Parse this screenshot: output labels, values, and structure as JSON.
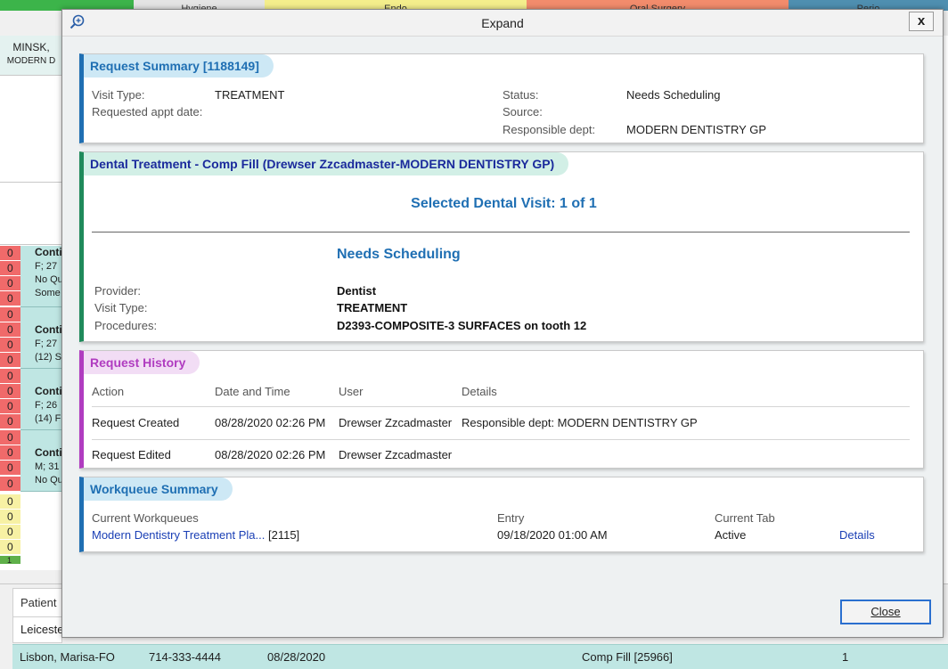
{
  "background": {
    "tabs": [
      {
        "label": "Hygiene",
        "color": "#e4e4e4"
      },
      {
        "label": "Endo",
        "color": "#f4ee8c"
      },
      {
        "label": "Oral Surgery",
        "color": "#f28c6c"
      },
      {
        "label": "Perio",
        "color": "#4f8fb0"
      }
    ],
    "column_header": {
      "name": "MINSK,",
      "dept": "MODERN D"
    },
    "counts": [
      "0",
      "0",
      "0",
      "0",
      "0",
      "0",
      "0",
      "0",
      "0",
      "0",
      "0",
      "0",
      "0",
      "0",
      "0",
      "0",
      "0",
      "0",
      "0",
      "0",
      "1"
    ],
    "appointments": [
      {
        "lines": [
          "Conti",
          "F; 27",
          "No Qu",
          "Some"
        ]
      },
      {
        "lines": [
          "Conti",
          "F; 27",
          "(12) S"
        ]
      },
      {
        "lines": [
          "Conti",
          "F; 26",
          "(14) F"
        ]
      },
      {
        "lines": [
          "Conti",
          "M; 31",
          "No Qu"
        ]
      }
    ],
    "bottom_table": {
      "header": "Patient",
      "cell": "Leiceste"
    },
    "selected_row": {
      "patient": "Lisbon, Marisa-FO",
      "phone": "714-333-4444",
      "date": "08/28/2020",
      "procedure": "Comp Fill [25966]",
      "count": "1"
    }
  },
  "window": {
    "title": "Expand",
    "close_x": "x"
  },
  "request_summary": {
    "header": "Request Summary [1188149]",
    "visit_type_label": "Visit Type:",
    "visit_type": "TREATMENT",
    "requested_date_label": "Requested appt date:",
    "requested_date": "",
    "status_label": "Status:",
    "status": "Needs Scheduling",
    "source_label": "Source:",
    "source": "",
    "dept_label": "Responsible dept:",
    "dept": "MODERN DENTISTRY GP"
  },
  "dental_treatment": {
    "header": "Dental Treatment - Comp Fill (Drewser Zzcadmaster-MODERN DENTISTRY GP)",
    "selected_visit": "Selected Dental Visit: 1 of 1",
    "status": "Needs Scheduling",
    "provider_label": "Provider:",
    "provider": "Dentist",
    "visit_type_label": "Visit Type:",
    "visit_type": "TREATMENT",
    "procedures_label": "Procedures:",
    "procedures": "D2393-COMPOSITE-3 SURFACES on tooth 12"
  },
  "request_history": {
    "header": "Request History",
    "columns": [
      "Action",
      "Date and Time",
      "User",
      "Details"
    ],
    "rows": [
      {
        "action": "Request Created",
        "datetime": "08/28/2020 02:26 PM",
        "user": "Drewser Zzcadmaster",
        "details": "Responsible dept: MODERN DENTISTRY GP"
      },
      {
        "action": "Request Edited",
        "datetime": "08/28/2020 02:26 PM",
        "user": "Drewser Zzcadmaster",
        "details": ""
      }
    ]
  },
  "workqueue_summary": {
    "header": "Workqueue Summary",
    "current_label": "Current Workqueues",
    "current_link": "Modern Dentistry Treatment Pla...",
    "current_id": "[2115]",
    "entry_label": "Entry",
    "entry": "09/18/2020 01:00 AM",
    "tab_label": "Current Tab",
    "tab": "Active",
    "details_link": "Details"
  },
  "footer": {
    "close_label": "Close"
  },
  "colors": {
    "summary_accent": "#1f6fb3",
    "summary_pill": "#cde8f5",
    "dental_accent": "#1f8a5b",
    "dental_pill": "#d2efe6",
    "history_accent": "#b03cc0",
    "history_pill": "#f2ddf5",
    "workqueue_accent": "#1f6fb3",
    "workqueue_pill": "#cde8f5"
  }
}
